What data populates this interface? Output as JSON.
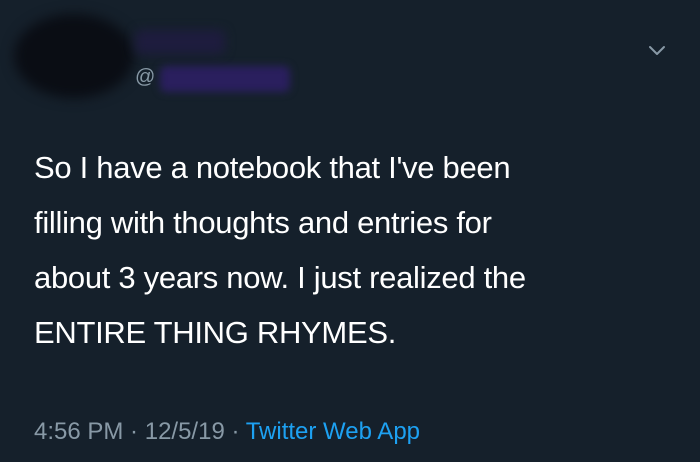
{
  "tweet": {
    "author": {
      "handle_prefix": "@"
    },
    "text_lines": [
      "So I have a notebook that I've been",
      "filling with thoughts and entries for",
      "about 3 years now. I just realized the",
      "ENTIRE THING RHYMES."
    ],
    "time": "4:56 PM",
    "separator": " · ",
    "date": "12/5/19",
    "source": "Twitter Web App"
  },
  "icons": {
    "menu": "chevron-down-icon"
  },
  "colors": {
    "background": "#15202b",
    "text": "#ffffff",
    "secondary_text": "#8899a6",
    "link": "#1da1f2"
  }
}
